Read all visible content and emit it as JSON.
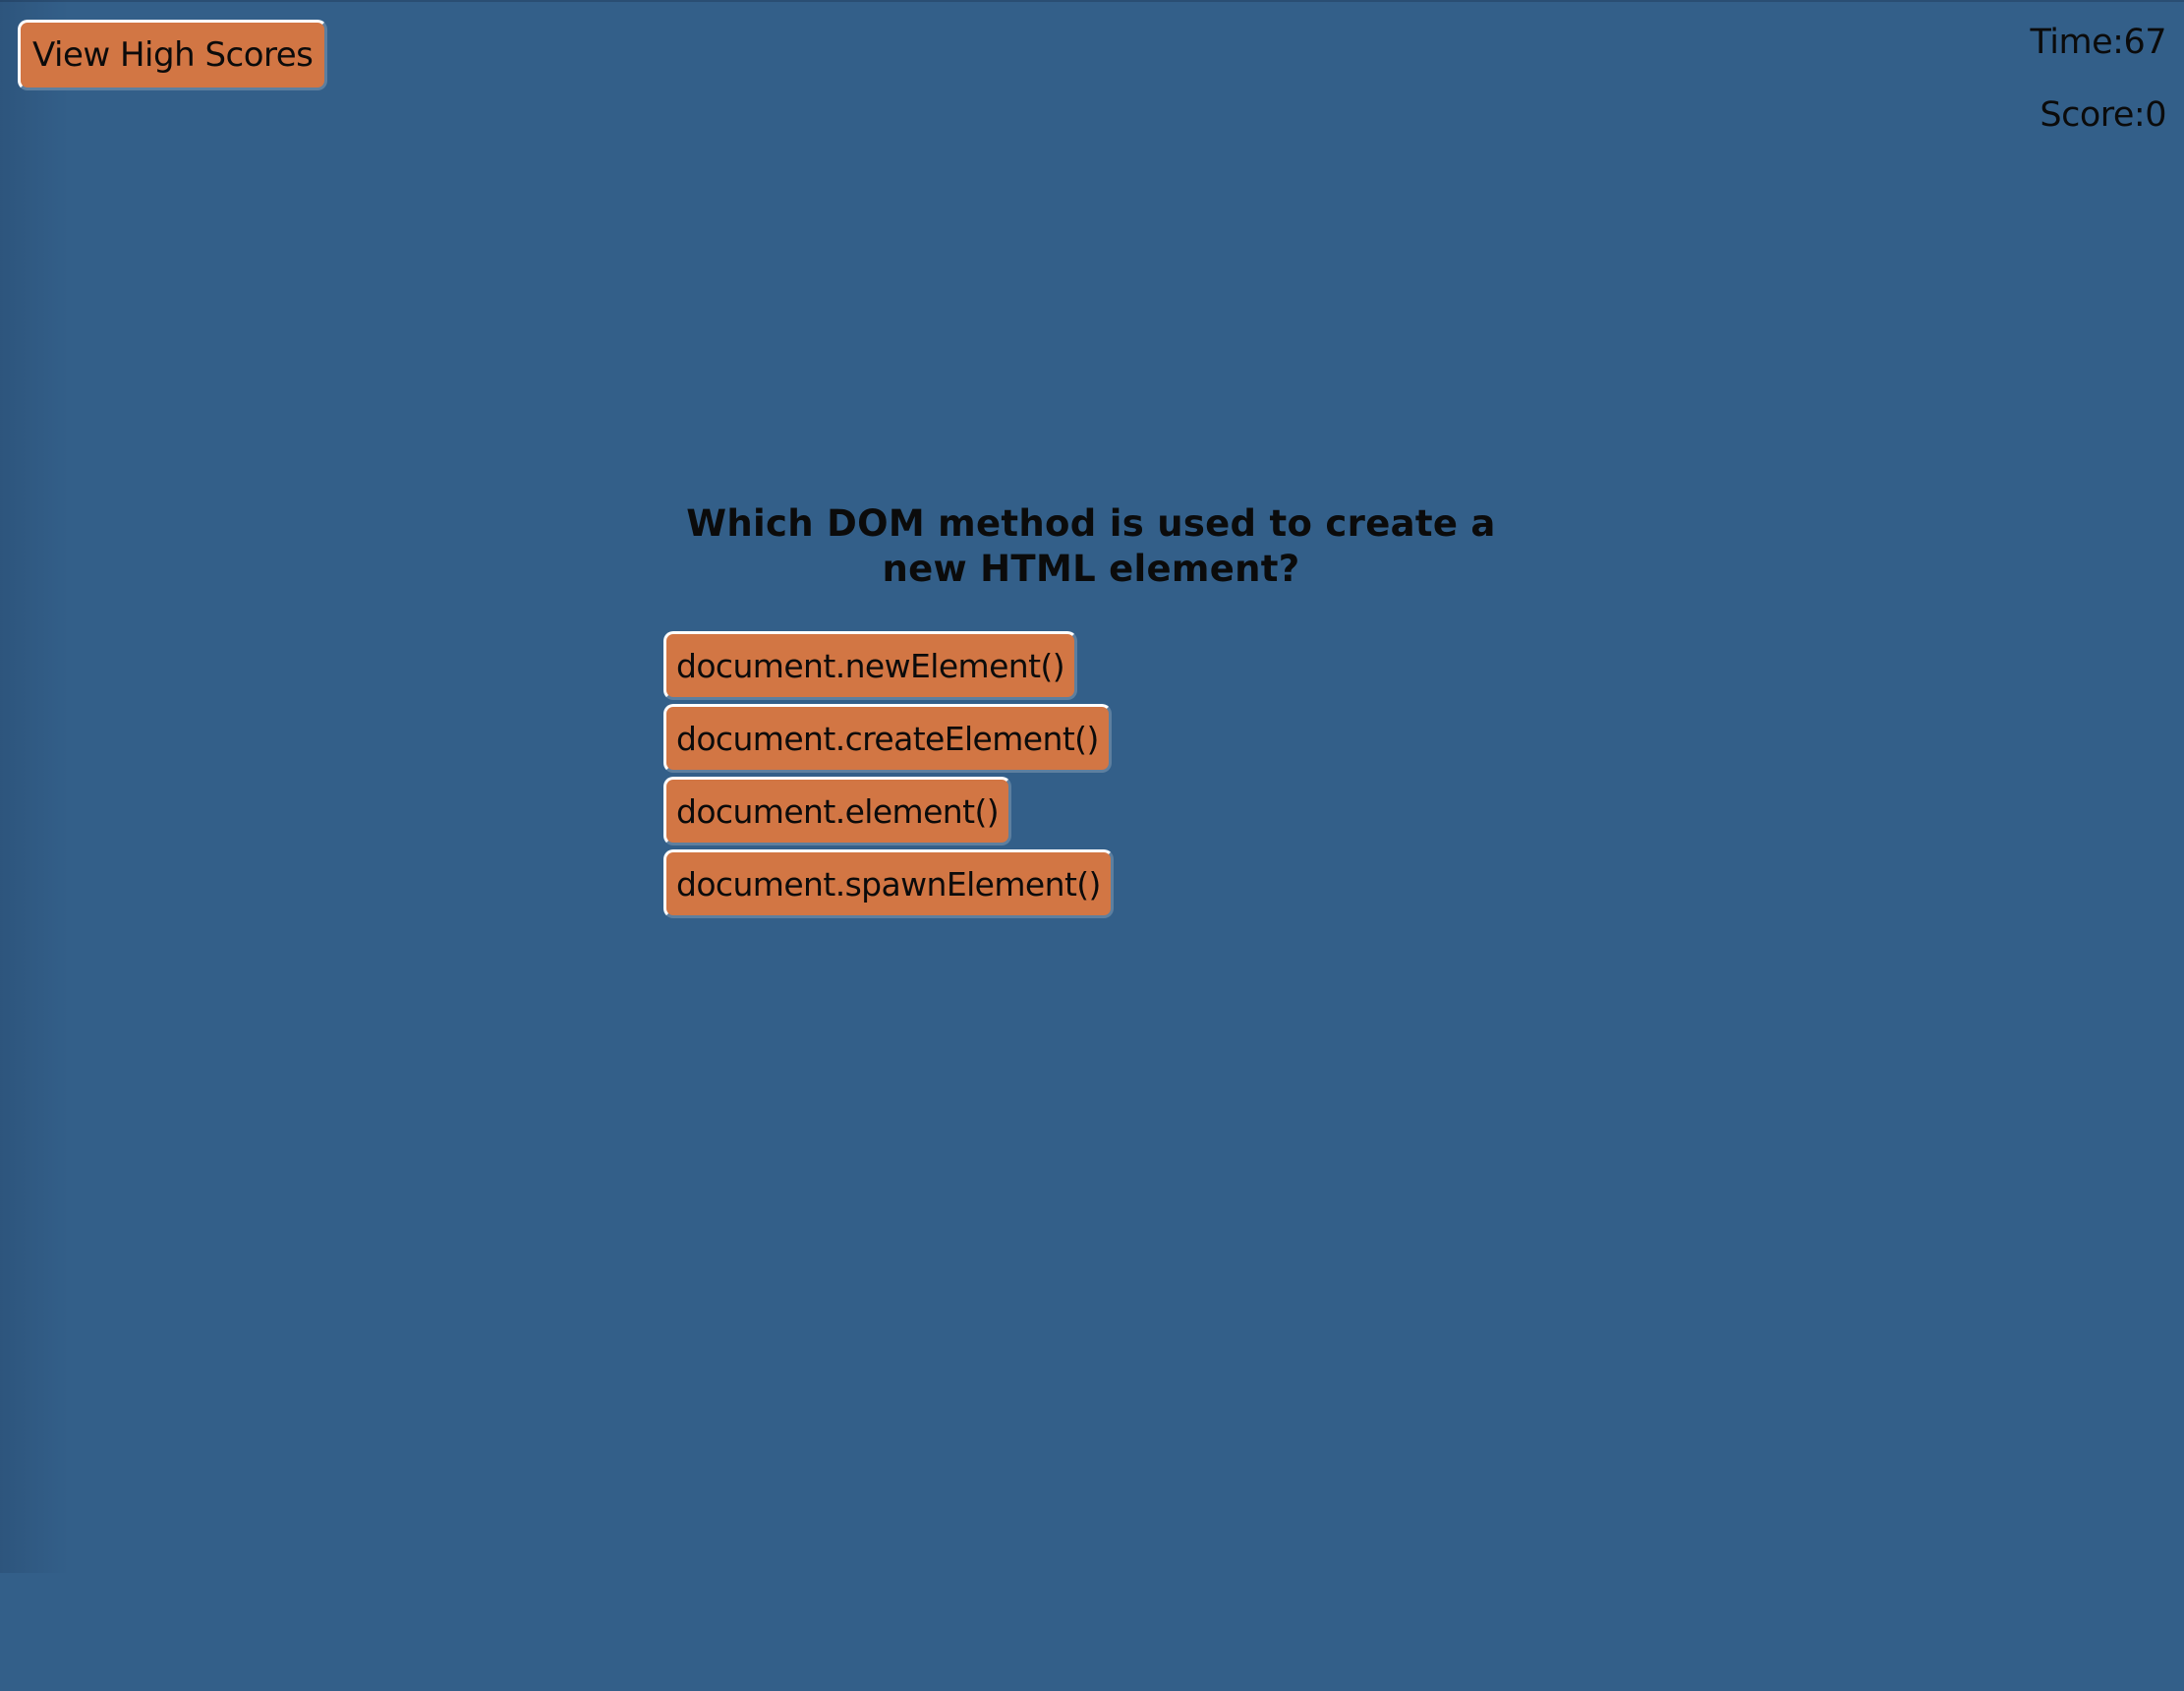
{
  "header": {
    "high_scores_label": "View High Scores",
    "time_label": "Time:",
    "time_value": "67",
    "score_label": "Score:",
    "score_value": "0"
  },
  "quiz": {
    "question_line1": "Which DOM method is used to create a",
    "question_line2": "new HTML element?",
    "answers": [
      {
        "label": "document.newElement()"
      },
      {
        "label": "document.createElement()"
      },
      {
        "label": "document.element()"
      },
      {
        "label": "document.spawnElement()"
      }
    ]
  },
  "colors": {
    "background": "#335f89",
    "button": "#d27644",
    "text": "#0b0b0b"
  }
}
